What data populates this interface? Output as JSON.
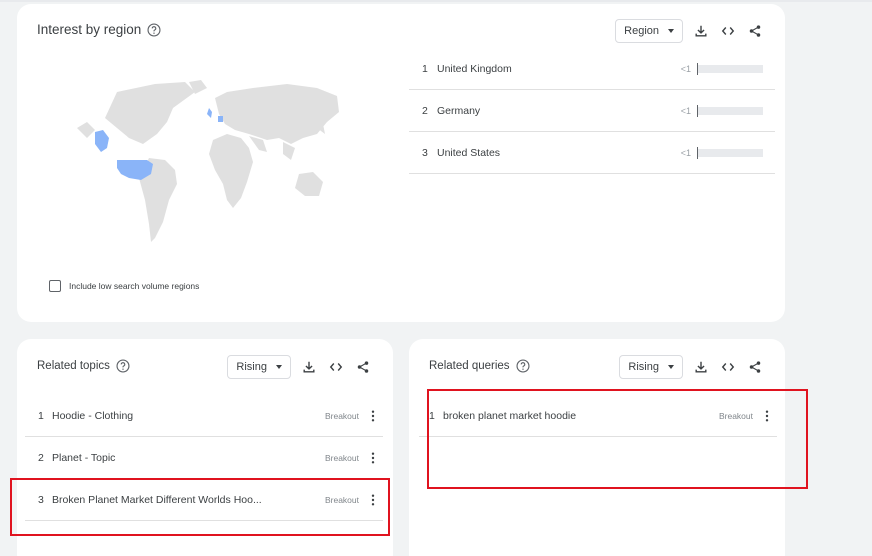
{
  "region": {
    "title": "Interest by region",
    "select_label": "Region",
    "checkbox_label": "Include low search volume regions",
    "rows": [
      {
        "rank": "1",
        "name": "United Kingdom",
        "value": "<1"
      },
      {
        "rank": "2",
        "name": "Germany",
        "value": "<1"
      },
      {
        "rank": "3",
        "name": "United States",
        "value": "<1"
      }
    ]
  },
  "topics": {
    "title": "Related topics",
    "select_label": "Rising",
    "rows": [
      {
        "rank": "1",
        "label": "Hoodie - Clothing",
        "badge": "Breakout"
      },
      {
        "rank": "2",
        "label": "Planet - Topic",
        "badge": "Breakout"
      },
      {
        "rank": "3",
        "label": "Broken Planet Market Different Worlds Hoo...",
        "badge": "Breakout"
      }
    ]
  },
  "queries": {
    "title": "Related queries",
    "select_label": "Rising",
    "rows": [
      {
        "rank": "1",
        "label": "broken planet market hoodie",
        "badge": "Breakout"
      }
    ]
  },
  "colors": {
    "map_land": "#e0e0e0",
    "map_highlight": "#8ab4f8",
    "annotation_red": "#e0131f"
  }
}
